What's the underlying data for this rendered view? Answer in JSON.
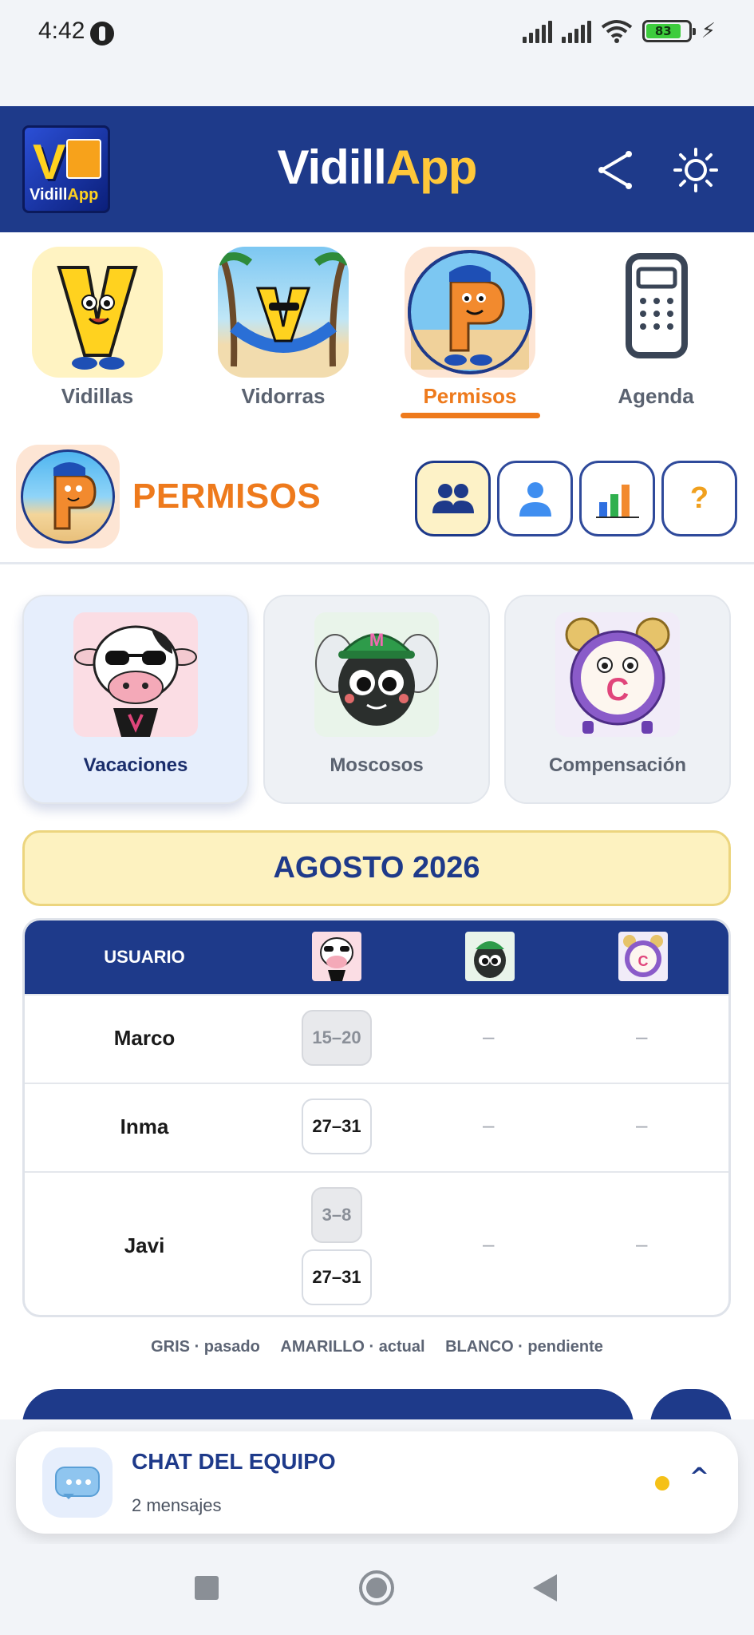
{
  "status_bar": {
    "time": "4:42",
    "battery": "83"
  },
  "header": {
    "title_part1": "Vidill",
    "title_part2": "App",
    "logo_text_part1": "Vidill",
    "logo_text_part2": "App",
    "logo_letter": "V"
  },
  "nav": {
    "tabs": [
      {
        "label": "Vidillas",
        "icon": "vidillas-mascot"
      },
      {
        "label": "Vidorras",
        "icon": "vidorras-mascot"
      },
      {
        "label": "Permisos",
        "icon": "permisos-mascot",
        "active": true
      },
      {
        "label": "Agenda",
        "icon": "phone-icon"
      }
    ]
  },
  "permisos": {
    "title": "PERMISOS",
    "segments": [
      {
        "icon": "group-icon",
        "active": true
      },
      {
        "icon": "user-icon"
      },
      {
        "icon": "chart-icon"
      },
      {
        "icon": "help-icon",
        "label": "?"
      }
    ]
  },
  "categories": [
    {
      "label": "Vacaciones",
      "icon": "cow-mascot",
      "active": true
    },
    {
      "label": "Moscosos",
      "icon": "fly-mascot"
    },
    {
      "label": "Compensación",
      "icon": "clock-mascot"
    }
  ],
  "month": "AGOSTO 2026",
  "table": {
    "header_user": "USUARIO",
    "rows": [
      {
        "name": "Marco",
        "vacaciones": [
          {
            "range": "15–20",
            "state": "past"
          }
        ],
        "moscosos": "–",
        "compensacion": "–"
      },
      {
        "name": "Inma",
        "vacaciones": [
          {
            "range": "27–31",
            "state": "pending"
          }
        ],
        "moscosos": "–",
        "compensacion": "–"
      },
      {
        "name": "Javi",
        "vacaciones": [
          {
            "range": "3–8",
            "state": "past"
          },
          {
            "range": "27–31",
            "state": "pending"
          }
        ],
        "moscosos": "–",
        "compensacion": "–"
      }
    ]
  },
  "legend": {
    "past": "GRIS · pasado",
    "current": "AMARILLO · actual",
    "pending": "BLANCO · pendiente"
  },
  "chat": {
    "title": "CHAT DEL EQUIPO",
    "subtitle": "2 mensajes",
    "caret": "^"
  },
  "colors": {
    "brand": "#1e3a8a",
    "accent": "#ee7a1c",
    "highlight": "#fdf2c0",
    "unread": "#f5c118"
  }
}
